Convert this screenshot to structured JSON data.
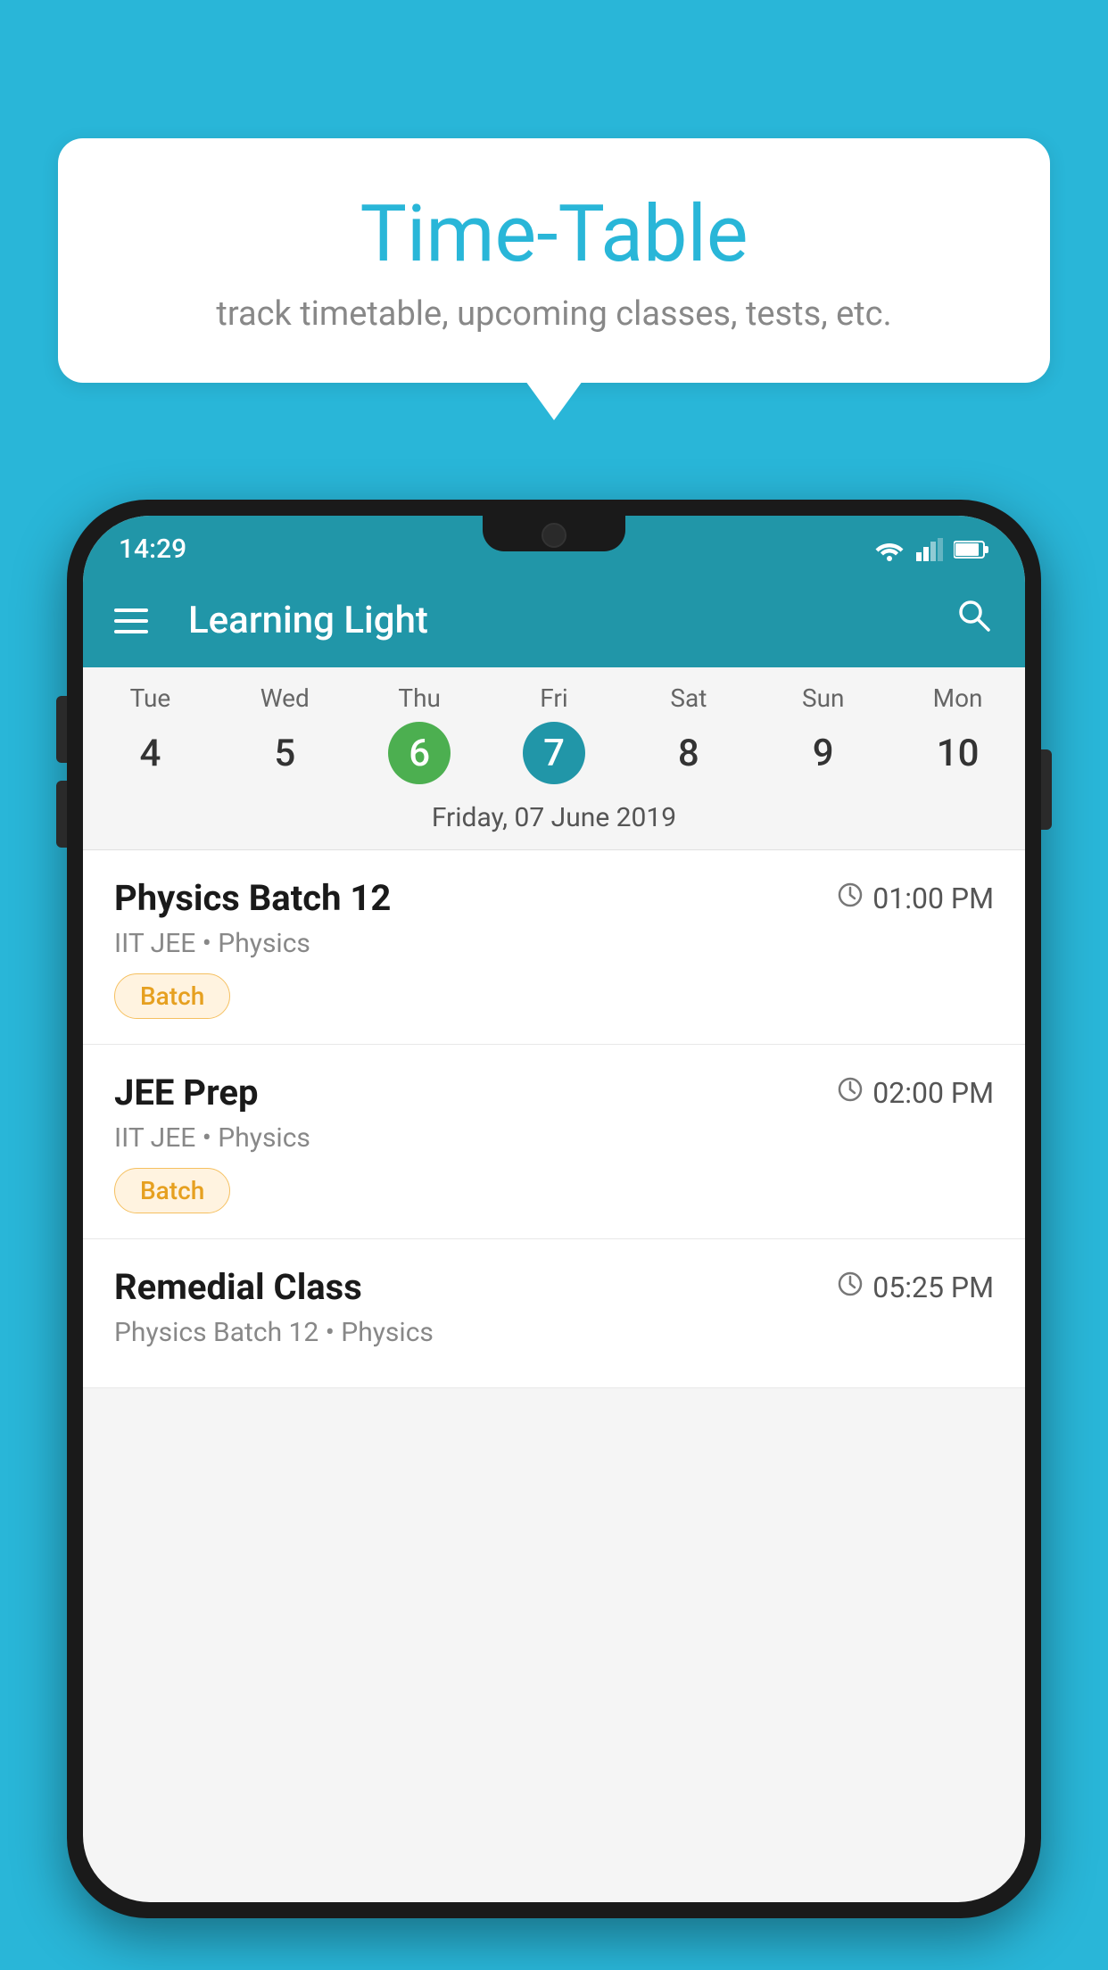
{
  "background_color": "#29b6d8",
  "tooltip": {
    "title": "Time-Table",
    "subtitle": "track timetable, upcoming classes, tests, etc."
  },
  "app": {
    "status_time": "14:29",
    "app_name": "Learning Light",
    "menu_icon": "hamburger-icon",
    "search_icon": "search-icon"
  },
  "calendar": {
    "days": [
      {
        "name": "Tue",
        "num": "4",
        "state": "normal"
      },
      {
        "name": "Wed",
        "num": "5",
        "state": "normal"
      },
      {
        "name": "Thu",
        "num": "6",
        "state": "today"
      },
      {
        "name": "Fri",
        "num": "7",
        "state": "selected"
      },
      {
        "name": "Sat",
        "num": "8",
        "state": "normal"
      },
      {
        "name": "Sun",
        "num": "9",
        "state": "normal"
      },
      {
        "name": "Mon",
        "num": "10",
        "state": "normal"
      }
    ],
    "selected_date_label": "Friday, 07 June 2019"
  },
  "schedule": [
    {
      "title": "Physics Batch 12",
      "time": "01:00 PM",
      "sub": "IIT JEE • Physics",
      "tag": "Batch"
    },
    {
      "title": "JEE Prep",
      "time": "02:00 PM",
      "sub": "IIT JEE • Physics",
      "tag": "Batch"
    },
    {
      "title": "Remedial Class",
      "time": "05:25 PM",
      "sub": "Physics Batch 12 • Physics",
      "tag": ""
    }
  ]
}
